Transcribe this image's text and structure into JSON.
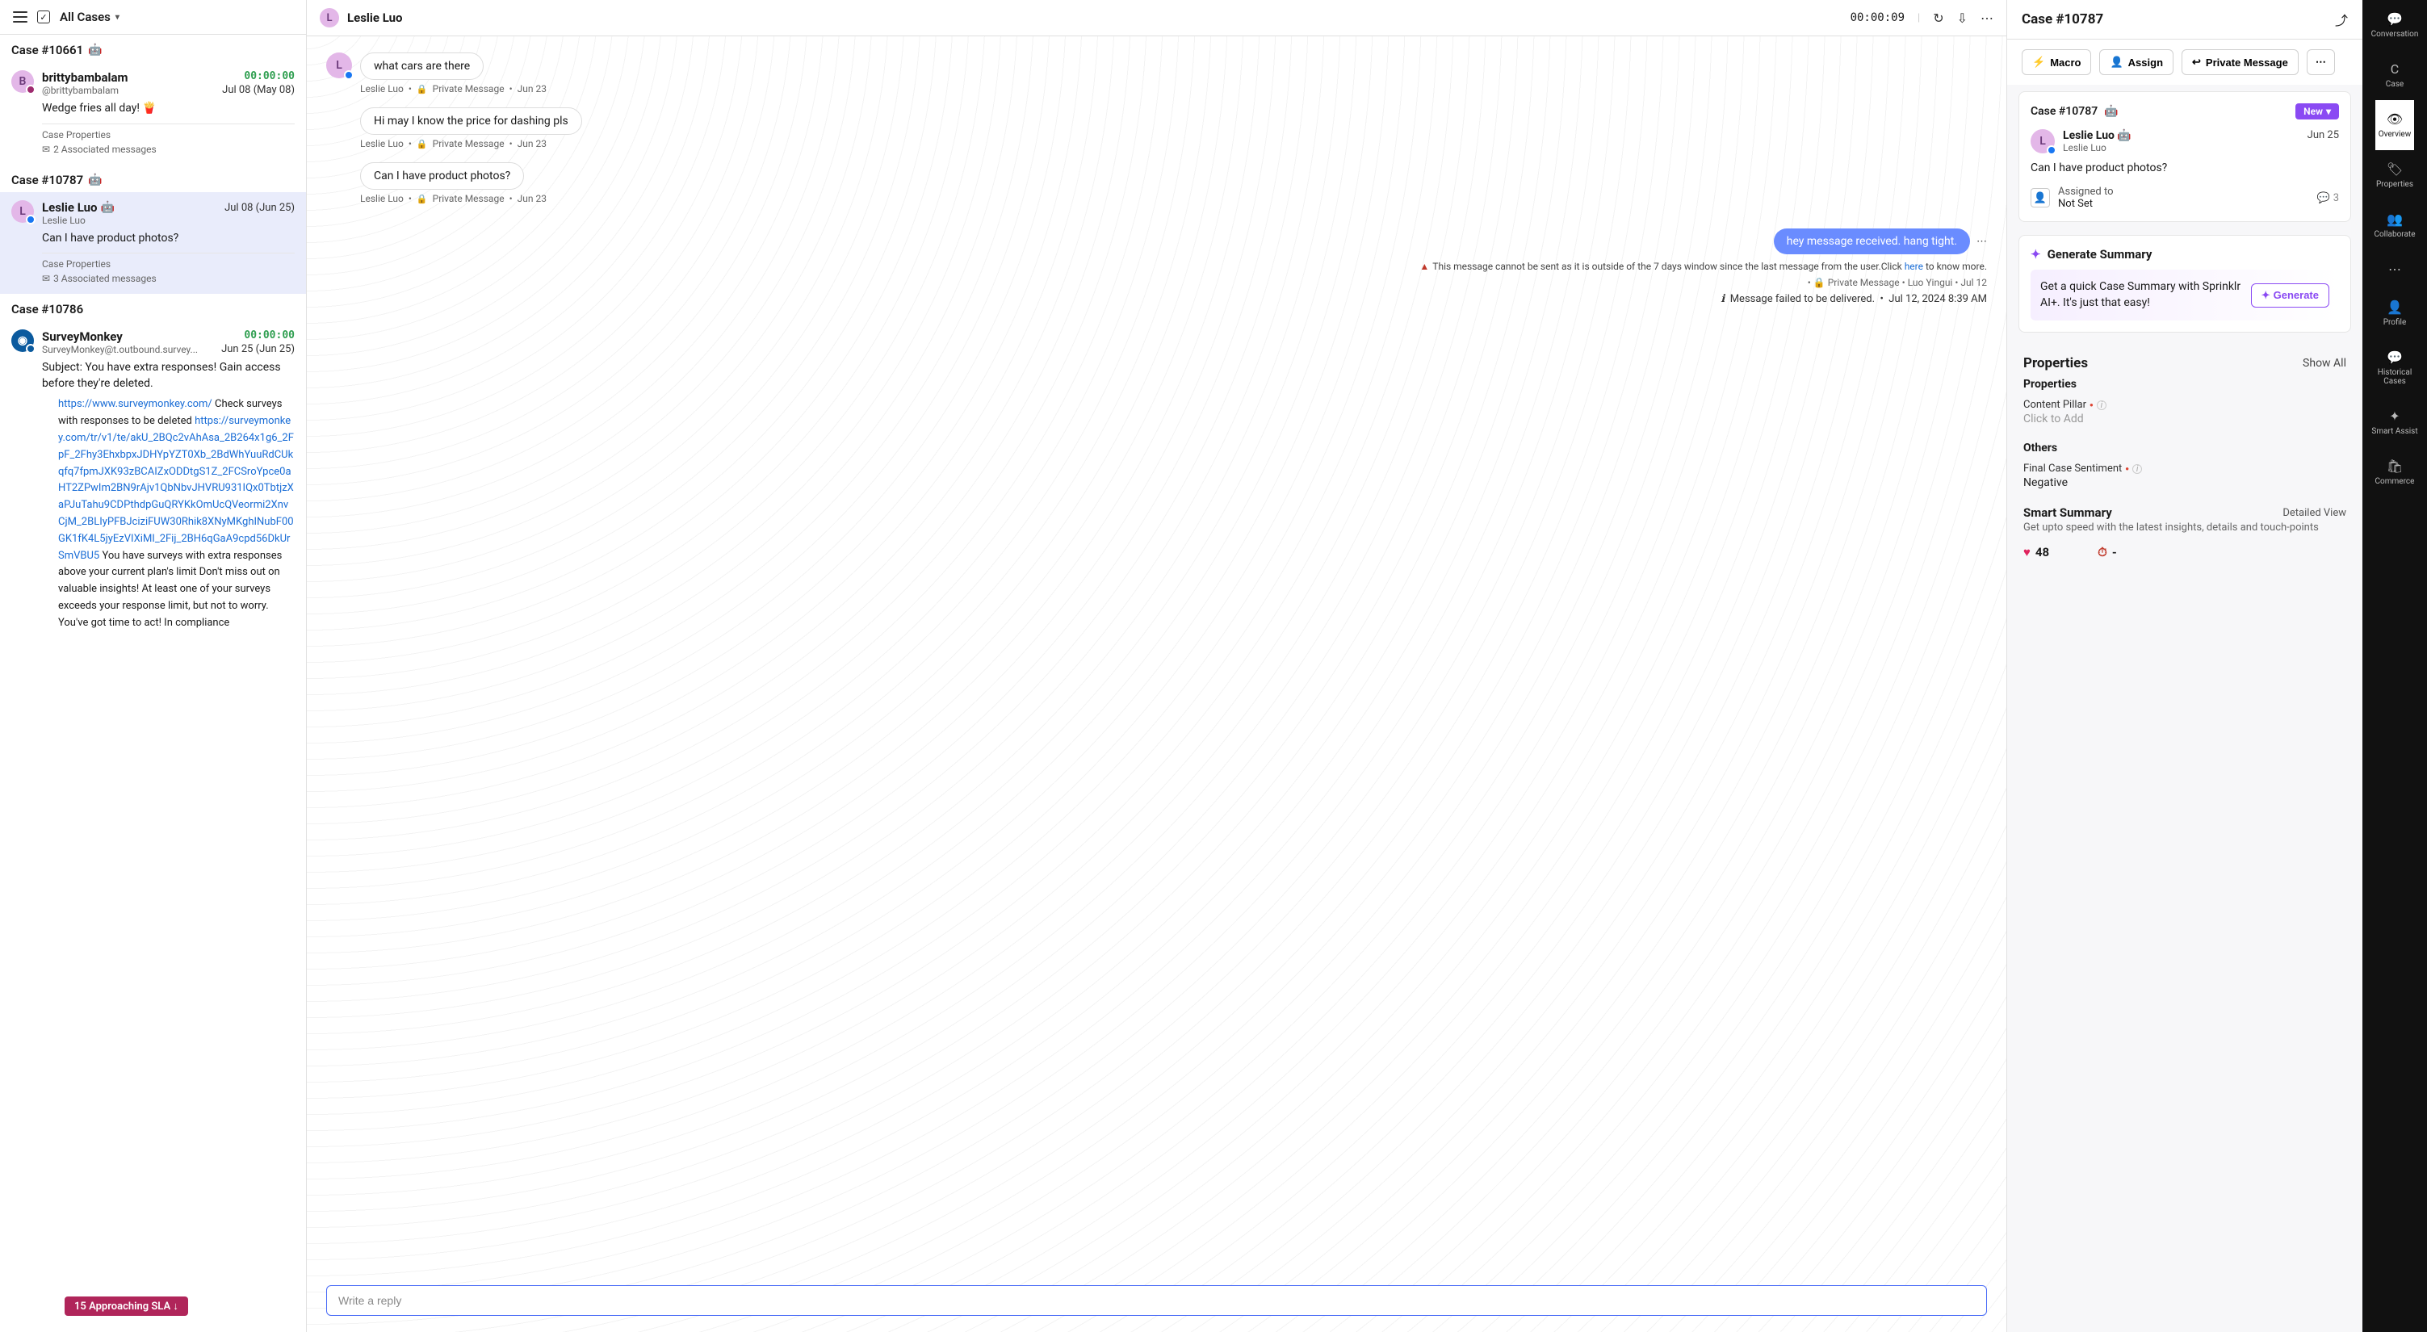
{
  "header": {
    "all_cases": "All Cases"
  },
  "cases": [
    {
      "id_label": "Case #10661",
      "avatar_letter": "B",
      "name": "brittybambalam",
      "handle": "@brittybambalam",
      "timer": "00:00:00",
      "date": "Jul 08 (May 08)",
      "preview": "Wedge fries all day! 🍟",
      "props_label": "Case Properties",
      "assoc": "2 Associated messages"
    },
    {
      "id_label": "Case #10787",
      "avatar_letter": "L",
      "name": "Leslie Luo",
      "handle": "Leslie Luo",
      "timer": "",
      "date": "Jul 08 (Jun 25)",
      "preview": "Can I have product photos?",
      "props_label": "Case Properties",
      "assoc": "3 Associated messages",
      "selected": true
    },
    {
      "id_label": "Case #10786",
      "avatar_letter": "",
      "name": "SurveyMonkey",
      "handle": "SurveyMonkey@t.outbound.survey...",
      "timer": "00:00:00",
      "date": "Jun 25 (Jun 25)",
      "subject": "Subject: You have extra responses! Gain access before they're deleted.",
      "link1": "https://www.surveymonkey.com/",
      "body1": " Check surveys with responses to be deleted ",
      "link2": "https://surveymonkey.com/tr/v1/te/akU_2BQc2vAhAsa_2B264x1g6_2FpF_2Fhy3EhxbpxJDHYpYZT0Xb_2BdWhYuuRdCUkqfq7fpmJXK93zBCAIZxODDtgS1Z_2FCSroYpce0aHT2ZPwIm2BN9rAjv1QbNbvJHVRU931IQx0TbtjzXaPJuTahu9CDPthdpGuQRYKkOmUcQVeormi2XnvCjM_2BLIyPFBJciziFUW30Rhik8XNyMKghINubF00GK1fK4L5jyEzVIXiMI_2Fij_2BH6qGaA9cpd56DkUrSmVBU5",
      "body2": " You have surveys with extra responses above your current plan's limit Don't miss out on valuable insights! At least one of your surveys exceeds your response limit, but not to worry. You've got time to act! In compliance"
    }
  ],
  "sla_pill": "15 Approaching SLA  ↓",
  "center": {
    "name": "Leslie Luo",
    "avatar_letter": "L",
    "timer": "00:00:09",
    "messages": [
      {
        "text": "what cars are there",
        "author": "Leslie Luo",
        "channel": "Private Message",
        "date": "Jun 23"
      },
      {
        "text": "Hi may I know the price for dashing pls",
        "author": "Leslie Luo",
        "channel": "Private Message",
        "date": "Jun 23"
      },
      {
        "text": "Can I have product photos?",
        "author": "Leslie Luo",
        "channel": "Private Message",
        "date": "Jun 23"
      }
    ],
    "outgoing": {
      "text": "hey message received. hang tight.",
      "error": "This message cannot be sent as it is outside of the 7 days window since the last message from the user.Click ",
      "error_link": "here",
      "error_tail": " to know more.",
      "channel": "Private Message",
      "agent": "Luo Yingui",
      "date": "Jul 12",
      "fail": "Message failed to be delivered.",
      "fail_ts": "Jul 12, 2024 8:39 AM"
    },
    "reply_placeholder": "Write a reply"
  },
  "right": {
    "title": "Case #10787",
    "macro": "Macro",
    "assign": "Assign",
    "private_msg": "Private Message",
    "case_id": "Case #10787",
    "new_label": "New",
    "person_name": "Leslie Luo",
    "person_handle": "Leslie Luo",
    "person_date": "Jun 25",
    "person_preview": "Can I have product photos?",
    "assigned_to": "Assigned to",
    "not_set": "Not Set",
    "comment_count": "3",
    "gen_summary": "Generate Summary",
    "gen_text": "Get a quick Case Summary with Sprinklr AI+. It's just that easy!",
    "gen_btn": "Generate",
    "properties": "Properties",
    "show_all": "Show All",
    "properties_sub": "Properties",
    "content_pillar": "Content Pillar",
    "click_add": "Click to Add",
    "others": "Others",
    "final_sentiment": "Final Case Sentiment",
    "negative": "Negative",
    "smart_summary": "Smart Summary",
    "detailed_view": "Detailed View",
    "smart_sub": "Get upto speed with the latest insights, details and touch-points",
    "stat_likes": "48",
    "stat_clock": "-"
  },
  "far_right": [
    {
      "icon": "💬",
      "label": "Conversation"
    },
    {
      "icon": "C",
      "label": "Case"
    },
    {
      "icon": "👁",
      "label": "Overview",
      "active": true
    },
    {
      "icon": "🏷",
      "label": "Properties"
    },
    {
      "icon": "👥",
      "label": "Collaborate"
    },
    {
      "icon": "⋯",
      "label": ""
    },
    {
      "icon": "👤",
      "label": "Profile"
    },
    {
      "icon": "💬",
      "label": "Historical Cases"
    },
    {
      "icon": "✦",
      "label": "Smart Assist"
    },
    {
      "icon": "🛍",
      "label": "Commerce"
    }
  ]
}
